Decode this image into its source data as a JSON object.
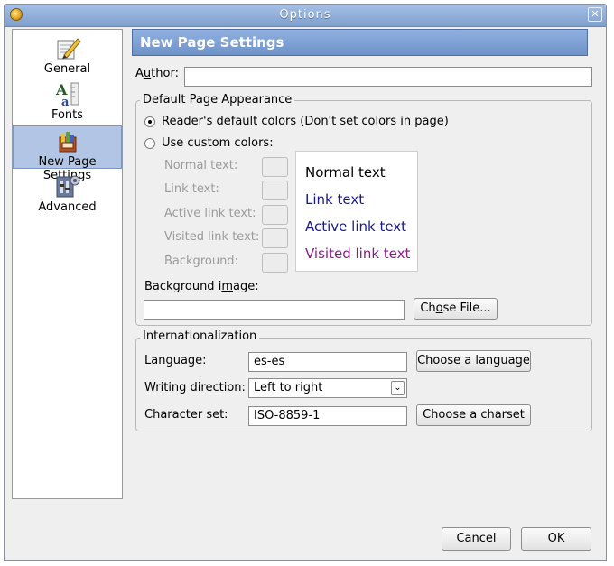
{
  "window": {
    "title": "Options",
    "close_glyph": "✕"
  },
  "sidebar": {
    "items": [
      {
        "label": "General",
        "icon": "pencil-paper-icon",
        "selected": false
      },
      {
        "label": "Fonts",
        "icon": "fonts-icon",
        "selected": false
      },
      {
        "label": "New Page Settings",
        "icon": "new-page-settings-icon",
        "selected": true
      },
      {
        "label": "Advanced",
        "icon": "advanced-icon",
        "selected": false
      }
    ]
  },
  "header": {
    "title": "New Page Settings"
  },
  "author": {
    "label": "Author:",
    "value": ""
  },
  "appearance": {
    "legend": "Default Page Appearance",
    "radio_default": "Reader's default colors (Don't set colors in page)",
    "radio_custom": "Use custom colors:",
    "selected": "default",
    "color_labels": [
      "Normal text:",
      "Link text:",
      "Active link text:",
      "Visited link text:",
      "Background:"
    ],
    "preview": [
      {
        "text": "Normal text",
        "color": "#000000"
      },
      {
        "text": "Link text",
        "color": "#1a1a8c"
      },
      {
        "text": "Active link text",
        "color": "#1a1a8c"
      },
      {
        "text": "Visited link text",
        "color": "#8b1a8b"
      }
    ],
    "bg_image_label": "Background image:",
    "bg_image_value": "",
    "choose_file": "Choose File..."
  },
  "i18n": {
    "legend": "Internationalization",
    "language_label": "Language:",
    "language_value": "es-es",
    "choose_language": "Choose a language",
    "direction_label": "Writing direction:",
    "direction_value": "Left to right",
    "charset_label": "Character set:",
    "charset_value": "ISO-8859-1",
    "choose_charset": "Choose a charset"
  },
  "footer": {
    "cancel": "Cancel",
    "ok": "OK"
  }
}
